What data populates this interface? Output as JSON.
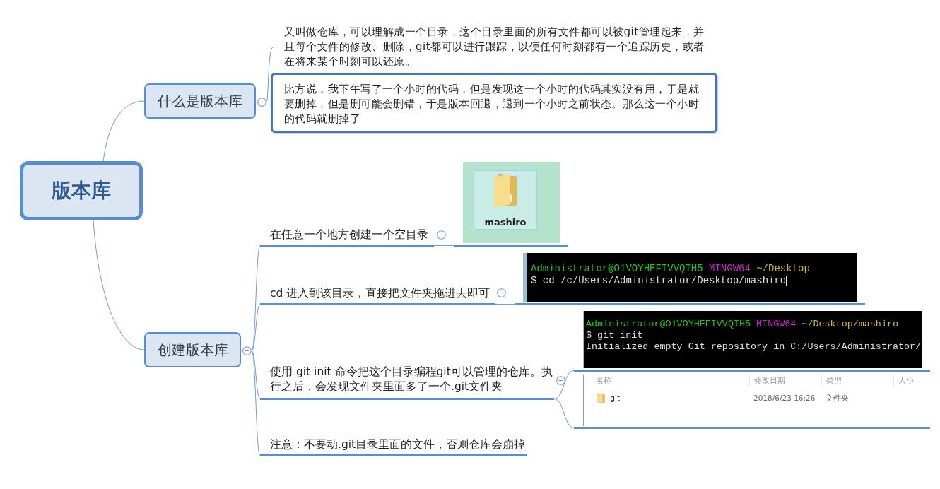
{
  "root": {
    "label": "版本库"
  },
  "branches": [
    {
      "label": "什么是版本库",
      "expanded": true,
      "children": [
        {
          "kind": "plain",
          "text": "又叫做仓库，可以理解成一个目录，这个目录里面的所有文件都可以被git管理起来，并且每个文件的修改、删除，git都可以进行跟踪，以便任何时刻都有一个追踪历史，或者在将来某个时刻可以还原。"
        },
        {
          "kind": "boxed",
          "text": "比方说，我下午写了一个小时的代码，但是发现这一个小时的代码其实没有用，于是就要删掉，但是删可能会删错，于是版本回退，退到一个小时之前状态。那么这一个小时的代码就删掉了"
        }
      ]
    },
    {
      "label": "创建版本库",
      "expanded": true,
      "children": [
        {
          "kind": "underlined",
          "text": "在任意一个地方创建一个空目录",
          "expanded": true,
          "attachments": [
            {
              "kind": "desktop",
              "items": [
                {
                  "label": "mashiro",
                  "selected": true
                }
              ]
            }
          ]
        },
        {
          "kind": "underlined",
          "text": "cd 进入到该目录，直接把文件夹拖进去即可",
          "expanded": true,
          "attachments": [
            {
              "kind": "terminal",
              "cursor": true,
              "lines": [
                [
                  {
                    "kind": "user",
                    "text": "Administrator@O1VOYHEFIVVQIH5"
                  },
                  {
                    "kind": "shell",
                    "text": "MINGW64"
                  },
                  {
                    "kind": "path",
                    "text": "~/Desktop"
                  }
                ],
                [
                  {
                    "kind": "plain",
                    "text": "$ cd /c/Users/Administrator/Desktop/mashiro"
                  }
                ]
              ]
            }
          ]
        },
        {
          "kind": "underlined",
          "text": "使用 git init 命令把这个目录编程git可以管理的仓库。执行之后，会发现文件夹里面多了一个.git文件夹",
          "expanded": true,
          "attachments": [
            {
              "kind": "terminal",
              "cursor": false,
              "lines": [
                [
                  {
                    "kind": "user",
                    "text": "Administrator@O1VOYHEFIVVQIH5"
                  },
                  {
                    "kind": "shell",
                    "text": "MINGW64"
                  },
                  {
                    "kind": "path",
                    "text": "~/Desktop/mashiro"
                  }
                ],
                [
                  {
                    "kind": "plain",
                    "text": "$ git init"
                  }
                ],
                [
                  {
                    "kind": "plain",
                    "text": "Initialized empty Git repository in C:/Users/Administrator/"
                  }
                ]
              ]
            },
            {
              "kind": "explorer",
              "columns": [
                "名称",
                "修改日期",
                "类型",
                "大小"
              ],
              "rows": [
                {
                  "name": ".git",
                  "modified": "2018/6/23 16:26",
                  "type": "文件夹"
                }
              ]
            }
          ]
        },
        {
          "kind": "underlined",
          "text": "注意：不要动.git目录里面的文件，否则仓库会崩掉"
        }
      ]
    }
  ]
}
